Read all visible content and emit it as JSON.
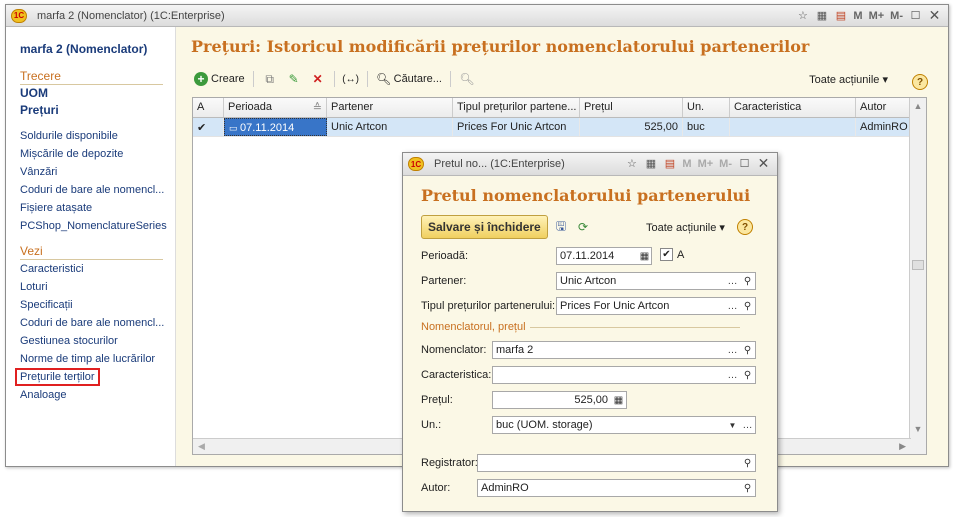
{
  "main_window": {
    "title": "marfa 2 (Nomenclator)   (1C:Enterprise)",
    "title_buttons": [
      "M",
      "M+",
      "M-"
    ]
  },
  "sidebar": {
    "header": "marfa 2 (Nomenclator)",
    "section_goto": "Trecere",
    "bold_items": [
      "UOM",
      "Prețuri"
    ],
    "items_goto": [
      "Soldurile disponibile",
      "Mișcările de depozite",
      "Vânzări",
      "Coduri de bare ale nomencl...",
      "Fișiere atașate",
      "PCShop_NomenclatureSeries"
    ],
    "section_see": "Vezi",
    "items_see": [
      "Caracteristici",
      "Loturi",
      "Specificații",
      "Coduri de bare ale nomencl...",
      "Gestiunea stocurilor",
      "Norme de timp ale lucrărilor",
      "Prețurile terților",
      "Analoage"
    ]
  },
  "main": {
    "title": "Prețuri: Istoricul modificării prețurilor nomenclatorului partenerilor",
    "toolbar": {
      "create": "Creare",
      "search": "Căutare...",
      "all_actions": "Toate acțiunile"
    },
    "columns": [
      "A",
      "Perioada",
      "Partener",
      "Tipul  prețurilor partene...",
      "Prețul",
      "Un.",
      "Caracteristica",
      "Autor"
    ],
    "rows": [
      {
        "active": "✔",
        "period": "07.11.2014",
        "partner": "Unic Artcon",
        "price_type": "Prices For Unic Artcon",
        "price": "525,00",
        "unit": "buc",
        "characteristic": "",
        "author": "AdminRO"
      }
    ]
  },
  "dialog": {
    "window_title": "Pretul no...   (1C:Enterprise)",
    "title": "Pretul nomenclatorului partenerului",
    "save_close": "Salvare și închidere",
    "all_actions": "Toate acțiunile",
    "labels": {
      "period": "Perioadă:",
      "partner": "Partener:",
      "price_type": "Tipul  prețurilor partenerului:",
      "group": "Nomenclatorul, prețul",
      "nomenclature": "Nomenclator:",
      "characteristic": "Caracteristica:",
      "price": "Prețul:",
      "unit": "Un.:",
      "registrar": "Registrator:",
      "author": "Autor:"
    },
    "values": {
      "period": "07.11.2014",
      "active_label": "A",
      "partner": "Unic Artcon",
      "price_type": "Prices For Unic Artcon",
      "nomenclature": "marfa 2",
      "characteristic": "",
      "price": "525,00",
      "unit": "buc (UOM. storage)",
      "registrar": "",
      "author": "AdminRO"
    }
  },
  "colors": {
    "accent_orange": "#c87020",
    "link_blue": "#1a3b7a",
    "highlight_red": "#e02020",
    "selected_row": "#d4e6f7",
    "bg_cream": "#fbf8e6"
  }
}
